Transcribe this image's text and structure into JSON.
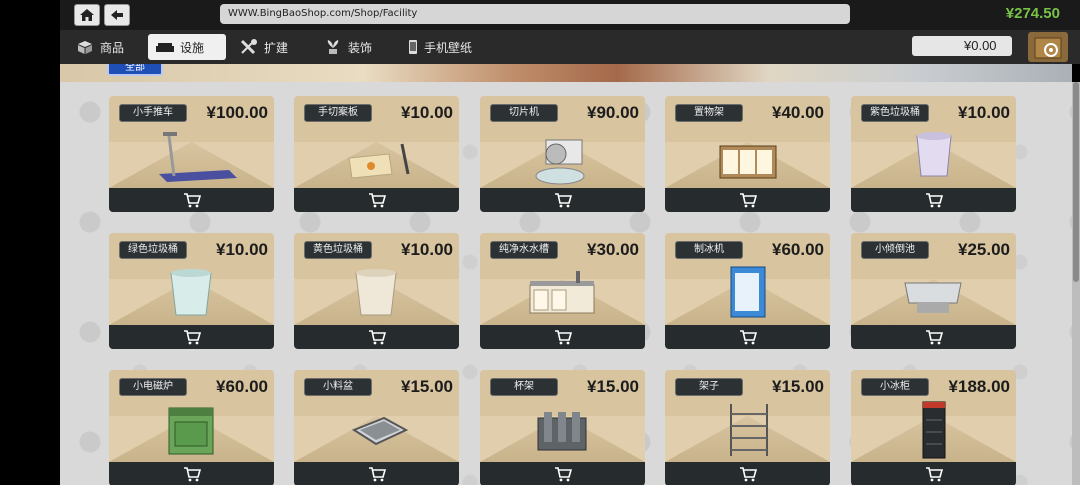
{
  "topbar": {
    "url": "WWW.BingBaoShop.com/Shop/Facility",
    "balance": "¥274.50"
  },
  "tabs": [
    {
      "label": "商品",
      "icon": "box-icon"
    },
    {
      "label": "设施",
      "icon": "sofa-icon",
      "active": true
    },
    {
      "label": "扩建",
      "icon": "tools-icon"
    },
    {
      "label": "装饰",
      "icon": "plant-icon"
    },
    {
      "label": "手机壁纸",
      "icon": "phone-icon"
    }
  ],
  "cart": {
    "total": "¥0.00",
    "icon": "cart-box-icon"
  },
  "filter_button": "全部",
  "products": [
    {
      "name": "小手推车",
      "price": "¥100.00",
      "icon": "hand-truck-icon"
    },
    {
      "name": "手切案板",
      "price": "¥10.00",
      "icon": "cutting-board-icon"
    },
    {
      "name": "切片机",
      "price": "¥90.00",
      "icon": "slicer-icon"
    },
    {
      "name": "置物架",
      "price": "¥40.00",
      "icon": "storage-cabinet-icon"
    },
    {
      "name": "紫色垃圾桶",
      "price": "¥10.00",
      "icon": "purple-bin-icon"
    },
    {
      "name": "绿色垃圾桶",
      "price": "¥10.00",
      "icon": "green-bin-icon"
    },
    {
      "name": "黄色垃圾桶",
      "price": "¥10.00",
      "icon": "yellow-bin-icon"
    },
    {
      "name": "纯净水水槽",
      "price": "¥30.00",
      "icon": "water-sink-icon"
    },
    {
      "name": "制冰机",
      "price": "¥60.00",
      "icon": "ice-machine-icon"
    },
    {
      "name": "小倾倒池",
      "price": "¥25.00",
      "icon": "small-sink-icon"
    },
    {
      "name": "小电磁炉",
      "price": "¥60.00",
      "icon": "induction-stove-icon"
    },
    {
      "name": "小料盆",
      "price": "¥15.00",
      "icon": "ingredient-tray-icon"
    },
    {
      "name": "杯架",
      "price": "¥15.00",
      "icon": "cup-rack-icon"
    },
    {
      "name": "架子",
      "price": "¥15.00",
      "icon": "shelf-icon"
    },
    {
      "name": "小冰柜",
      "price": "¥188.00",
      "icon": "fridge-icon"
    }
  ],
  "buy_icon": "cart-icon",
  "colors": {
    "balance": "#79c24a",
    "card_bg": "#d8c49f",
    "card_footer": "#262b2d",
    "active_tab": "#f0f0f0"
  }
}
